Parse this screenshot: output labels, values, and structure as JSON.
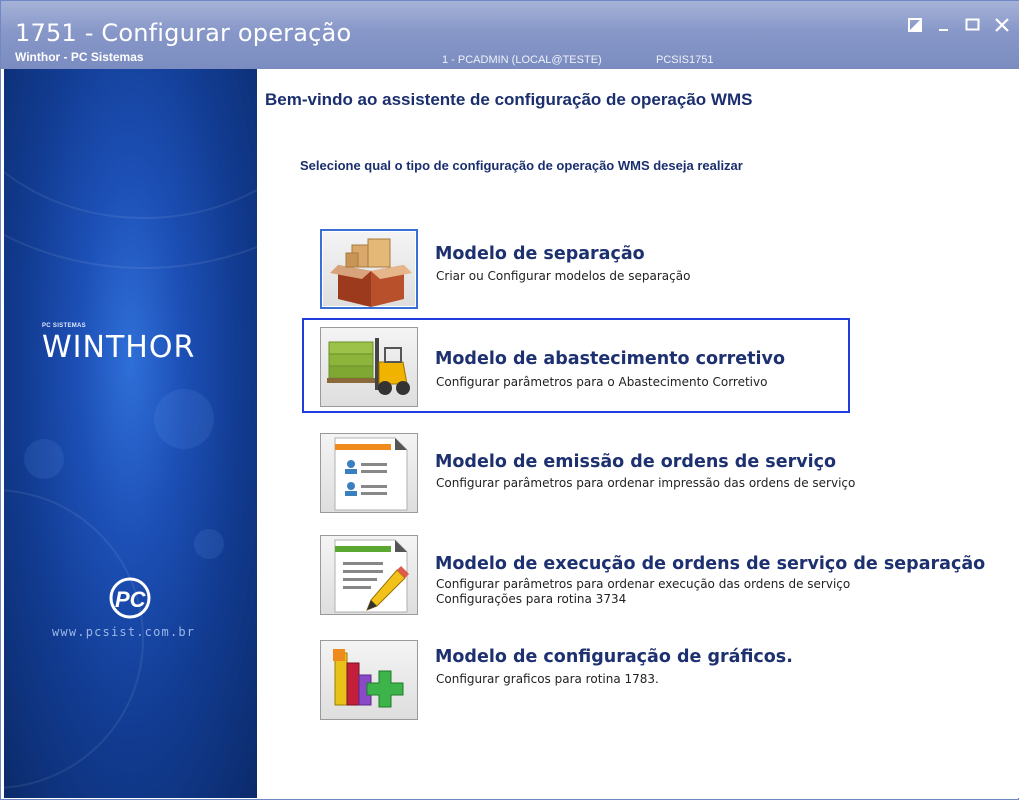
{
  "window": {
    "title": "1751 - Configurar operação",
    "subtitle": "Winthor - PC Sistemas",
    "user_info": "1 - PCADMIN (LOCAL@TESTE)",
    "program_code": "PCSIS1751"
  },
  "sidebar": {
    "brand_small": "PC SISTEMAS",
    "brand_logo": "WINTHOR",
    "website": "www.pcsist.com.br"
  },
  "main": {
    "welcome": "Bem-vindo ao assistente de configuração de operação WMS",
    "instruction": "Selecione qual o tipo de configuração de operação WMS deseja realizar",
    "options": [
      {
        "title": "Modelo de separação",
        "description": "Criar ou Configurar modelos de separação",
        "icon": "box-icon"
      },
      {
        "title": "Modelo de abastecimento corretivo",
        "description": "Configurar parâmetros para o Abastecimento Corretivo",
        "icon": "forklift-icon"
      },
      {
        "title": "Modelo de emissão de ordens de serviço",
        "description": "Configurar parâmetros para ordenar impressão das ordens de serviço",
        "icon": "document-users-icon"
      },
      {
        "title": "Modelo de execução de ordens de serviço de separação",
        "description": "Configurar parâmetros para ordenar execução das ordens de serviço",
        "description2": "Configurações para rotina 3734",
        "icon": "document-edit-icon"
      },
      {
        "title": "Modelo de configuração de gráficos.",
        "description": "Configurar graficos para rotina 1783.",
        "icon": "chart-add-icon"
      }
    ]
  },
  "colors": {
    "title_bar": "#8797c8",
    "sidebar": "#123c92",
    "heading": "#1b2f6e",
    "focus": "#1f3ce0"
  }
}
